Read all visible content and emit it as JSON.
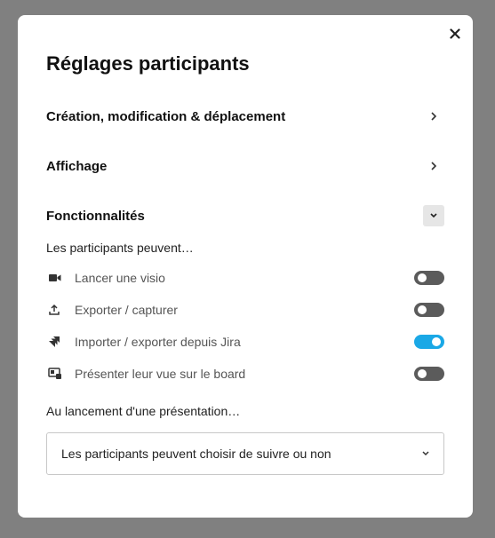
{
  "modal": {
    "title": "Réglages participants",
    "close_icon": "close-icon"
  },
  "sections": [
    {
      "label": "Création, modification & déplacement",
      "icon": "chevron-right-icon",
      "expanded": false
    },
    {
      "label": "Affichage",
      "icon": "chevron-right-icon",
      "expanded": false
    },
    {
      "label": "Fonctionnalités",
      "icon": "chevron-down-icon",
      "expanded": true
    }
  ],
  "features": {
    "intro": "Les participants peuvent…",
    "options": [
      {
        "label": "Lancer une visio",
        "icon": "video-camera-icon",
        "enabled": false
      },
      {
        "label": "Exporter / capturer",
        "icon": "upload-icon",
        "enabled": false
      },
      {
        "label": "Importer / exporter depuis Jira",
        "icon": "jira-icon",
        "enabled": true
      },
      {
        "label": "Présenter leur vue sur le board",
        "icon": "present-screen-icon",
        "enabled": false
      }
    ]
  },
  "presentation": {
    "label": "Au lancement d'une présentation…",
    "selected": "Les participants peuvent choisir de suivre ou non"
  },
  "colors": {
    "toggle_on": "#1aa8e6",
    "toggle_off": "#5b5b5b",
    "backdrop": "#808080"
  }
}
